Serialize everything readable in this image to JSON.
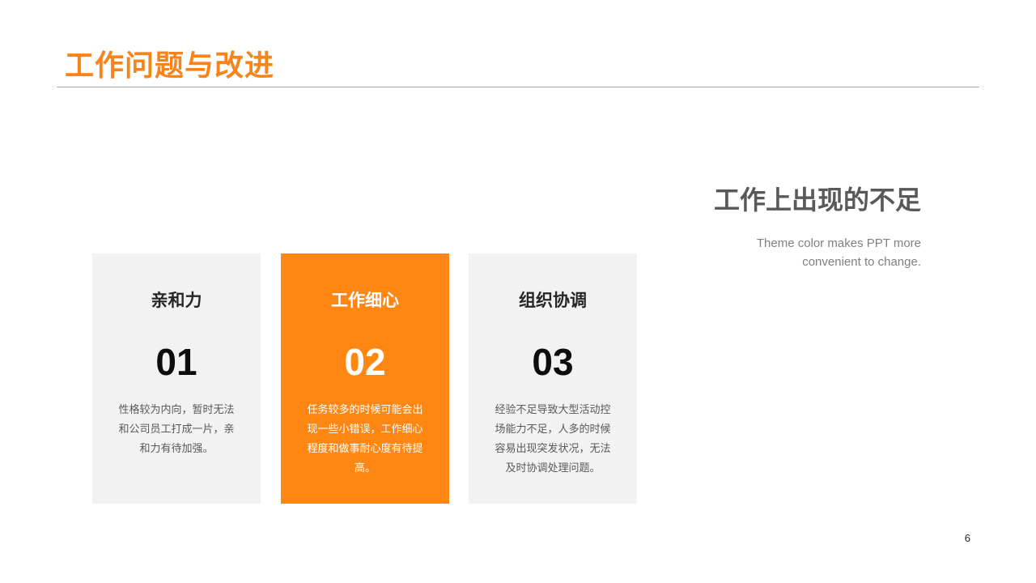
{
  "slide": {
    "title": "工作问题与改进",
    "page_number": "6",
    "accent_color": "#f7841b",
    "card_highlight_color": "#fe8713"
  },
  "side": {
    "title": "工作上出现的不足",
    "subtitle": "Theme color makes PPT more convenient to change."
  },
  "cards": [
    {
      "title": "亲和力",
      "number": "01",
      "description": "性格较为内向，暂时无法和公司员工打成一片，亲和力有待加强。"
    },
    {
      "title": "工作细心",
      "number": "02",
      "description": "任务较多的时候可能会出现一些小错误，工作细心程度和做事耐心度有待提高。"
    },
    {
      "title": "组织协调",
      "number": "03",
      "description": "经验不足导致大型活动控场能力不足，人多的时候容易出现突发状况，无法及时协调处理问题。"
    }
  ]
}
